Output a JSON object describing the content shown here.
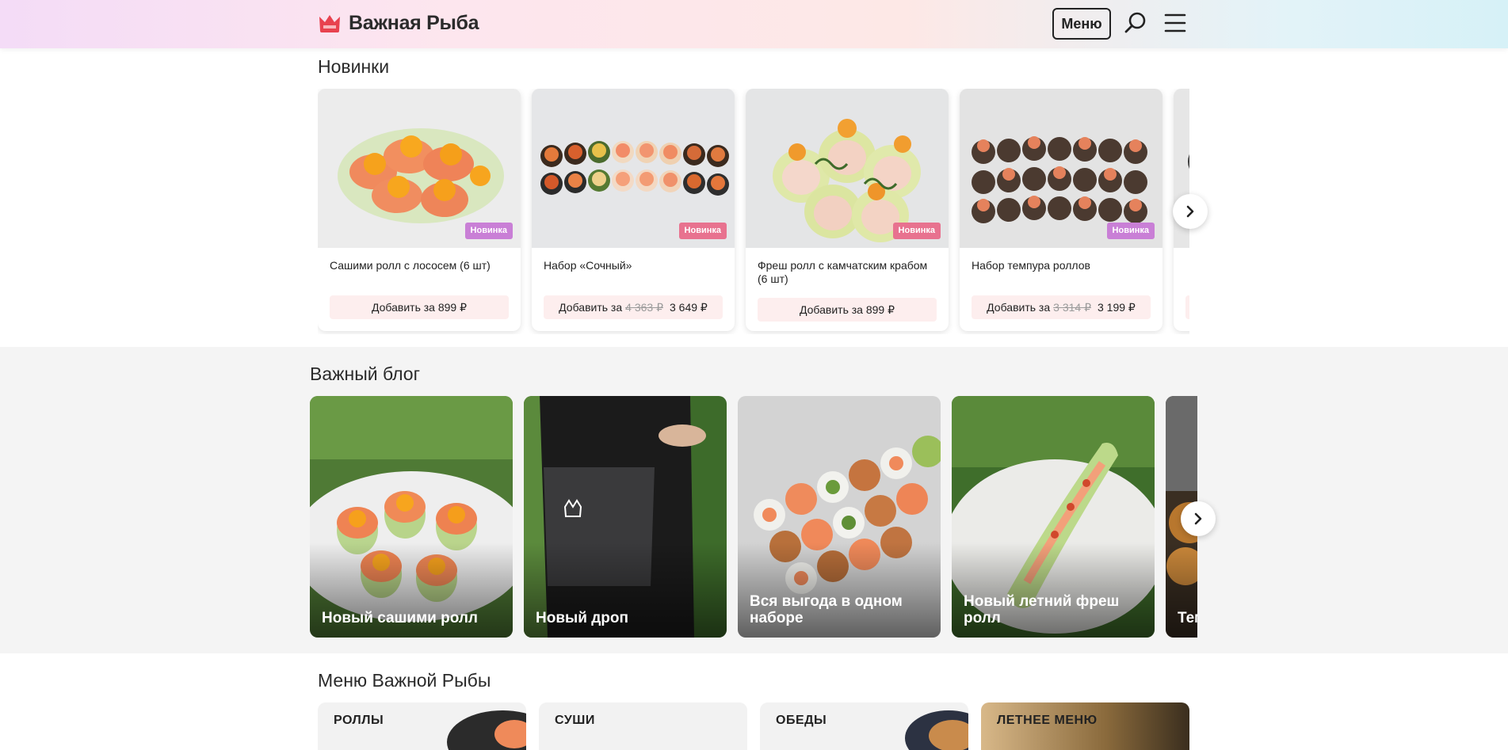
{
  "header": {
    "logo_text": "Важная Рыба",
    "menu_button": "Меню",
    "icons": [
      "crown-logo-icon",
      "search-icon",
      "burger-menu-icon"
    ],
    "colors": {
      "logo_accent": "#e8424f",
      "text": "#222222"
    }
  },
  "new_section": {
    "title": "Новинки",
    "items": [
      {
        "name": "Сашими ролл с лососем (6 шт)",
        "badge": "Новинка",
        "button_prefix": "Добавить за",
        "price": "899 ₽",
        "old_price": ""
      },
      {
        "name": "Набор «Сочный»",
        "badge": "Новинка",
        "button_prefix": "Добавить за",
        "price": "3 649 ₽",
        "old_price": "4 363 ₽"
      },
      {
        "name": "Фреш ролл с камчатским крабом (6 шт)",
        "badge": "Новинка",
        "button_prefix": "Добавить за",
        "price": "899 ₽",
        "old_price": ""
      },
      {
        "name": "Набор темпура роллов",
        "badge": "Новинка",
        "button_prefix": "Добавить за",
        "price": "3 199 ₽",
        "old_price": "3 314 ₽"
      }
    ],
    "badge_colors": [
      "#c97fd6",
      "#e8728f",
      "#e8728f",
      "#c97fd6"
    ]
  },
  "blog_section": {
    "title": "Важный блог",
    "items": [
      {
        "title": "Новый сашими ролл"
      },
      {
        "title": "Новый дроп"
      },
      {
        "title": "Вся выгода в одном наборе"
      },
      {
        "title": "Новый летний фреш ролл"
      },
      {
        "title": "Тем"
      }
    ]
  },
  "menu_section": {
    "title": "Меню Важной Рыбы",
    "categories": [
      "РОЛЛЫ",
      "СУШИ",
      "ОБЕДЫ",
      "ЛЕТНЕЕ МЕНЮ"
    ]
  }
}
